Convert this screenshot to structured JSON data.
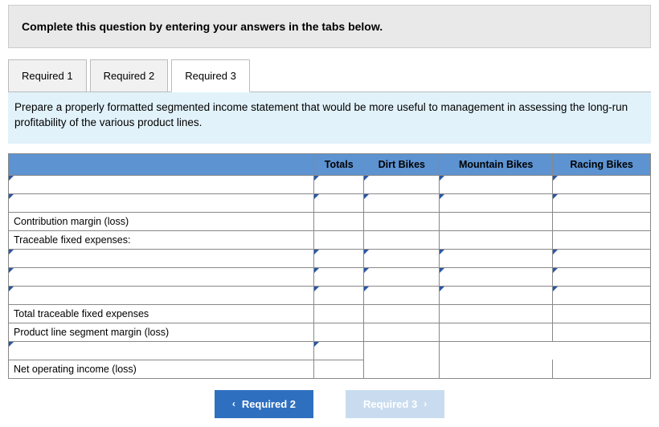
{
  "instruction": "Complete this question by entering your answers in the tabs below.",
  "tabs": [
    {
      "label": "Required 1"
    },
    {
      "label": "Required 2"
    },
    {
      "label": "Required 3"
    }
  ],
  "active_tab_index": 2,
  "prompt": "Prepare a properly formatted segmented income statement that would be more useful to management in assessing the long-run profitability of the various product lines.",
  "columns": {
    "totals": "Totals",
    "dirt": "Dirt Bikes",
    "mountain": "Mountain Bikes",
    "racing": "Racing Bikes"
  },
  "row_labels": {
    "contribution_margin": "Contribution margin (loss)",
    "traceable_fixed_header": "Traceable fixed expenses:",
    "total_traceable": "Total traceable fixed expenses",
    "segment_margin": "Product line segment margin (loss)",
    "net_operating": "Net operating income (loss)"
  },
  "nav": {
    "prev": "Required 2",
    "next": "Required 3"
  }
}
